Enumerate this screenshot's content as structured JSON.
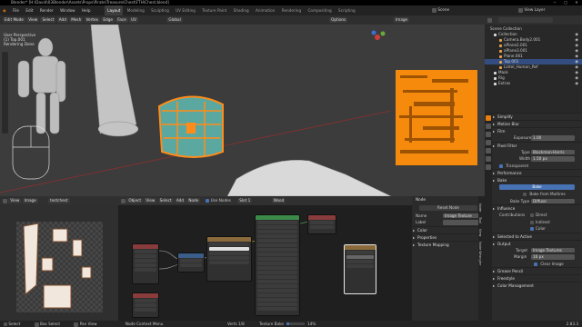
{
  "title_bar": {
    "text": "Blender* [H:\\David\\03Blender\\Assets\\Props\\Pirate\\Treasure\\Chest\\FTH\\Chest.blend]"
  },
  "menu": [
    "File",
    "Edit",
    "Render",
    "Window",
    "Help"
  ],
  "workspaces": [
    "Layout",
    "Modeling",
    "Sculpting",
    "UV Editing",
    "Texture Paint",
    "Shading",
    "Animation",
    "Rendering",
    "Compositing",
    "Scripting"
  ],
  "active_workspace": "Layout",
  "scene": {
    "label": "Scene",
    "view_layer": "View Layer"
  },
  "viewport": {
    "mode": "Edit Mode",
    "menus": [
      "View",
      "Select",
      "Add",
      "Mesh",
      "Vertex",
      "Edge",
      "Face",
      "UV"
    ],
    "orientation": "Global",
    "options": "Options",
    "overlay_line1": "User Perspective",
    "overlay_line2": "(1) Top.001",
    "overlay_line3": "Rendering Done"
  },
  "image_editor_top": {
    "label": "Image"
  },
  "outliner": {
    "header": "Scene Collection",
    "items": [
      {
        "label": "Collection",
        "indent": 1,
        "selected": false
      },
      {
        "label": "Camera.Body2.001",
        "indent": 2,
        "selected": false
      },
      {
        "label": "aPlane2.001",
        "indent": 2,
        "selected": false
      },
      {
        "label": "aPlane3.001",
        "indent": 2,
        "selected": false
      },
      {
        "label": "Plane.001",
        "indent": 2,
        "selected": false
      },
      {
        "label": "Top.001",
        "indent": 2,
        "selected": true
      },
      {
        "label": "Lintel_Human_Ref",
        "indent": 2,
        "selected": false
      },
      {
        "label": "Mask",
        "indent": 1,
        "selected": false
      },
      {
        "label": "Rig",
        "indent": 1,
        "selected": false
      },
      {
        "label": "Extras",
        "indent": 1,
        "selected": false
      }
    ]
  },
  "properties": {
    "sections_top": [
      "Simplify",
      "Motion Blur",
      "Film"
    ],
    "exposure_label": "Exposure",
    "exposure_value": "1.00",
    "pixel_filter": "Pixel Filter",
    "type_label": "Type",
    "type_value": "Blackman-Harris",
    "width_label": "Width",
    "width_value": "1.50 px",
    "transparent": "Transparent",
    "sections_mid": [
      "Performance",
      "Bake"
    ],
    "bake_btn": "Bake",
    "bake_multires": "Bake from Multires",
    "bake_type_label": "Bake Type",
    "bake_type_value": "Diffuse",
    "influence": "Influence",
    "contributions_label": "Contributions",
    "direct": "Direct",
    "indirect": "Indirect",
    "color": "Color",
    "selected_to_active": "Selected to Active",
    "output": "Output",
    "target_label": "Target",
    "target_value": "Image Textures",
    "margin_label": "Margin",
    "margin_value": "16 px",
    "clear_image": "Clear Image",
    "sections_bottom": [
      "Grease Pencil",
      "Freestyle",
      "Color Management"
    ]
  },
  "uv_editor": {
    "menus": [
      "View",
      "Image"
    ],
    "image_name": "testchest"
  },
  "node_editor": {
    "object": "Object",
    "menus": [
      "View",
      "Select",
      "Add",
      "Node"
    ],
    "use_nodes": "Use Nodes",
    "slot": "Slot 1",
    "material": "Wood"
  },
  "node_sidebar": {
    "tab": "Node",
    "name_label": "Name",
    "name_value": "Image Texture",
    "label_label": "Label",
    "reset": "Reset Node",
    "color": "Color",
    "properties": "Properties",
    "texture_mapping": "Texture Mapping",
    "side_tabs": [
      "Node",
      "Tool",
      "View",
      "Node Wrangler"
    ]
  },
  "status_bar": {
    "left": [
      "Select",
      "Box Select",
      "Pan View"
    ],
    "center": "Node Context Menu",
    "right": [
      "Verts 1/8",
      "Texture Bake",
      "14%",
      "2.83.3"
    ]
  }
}
